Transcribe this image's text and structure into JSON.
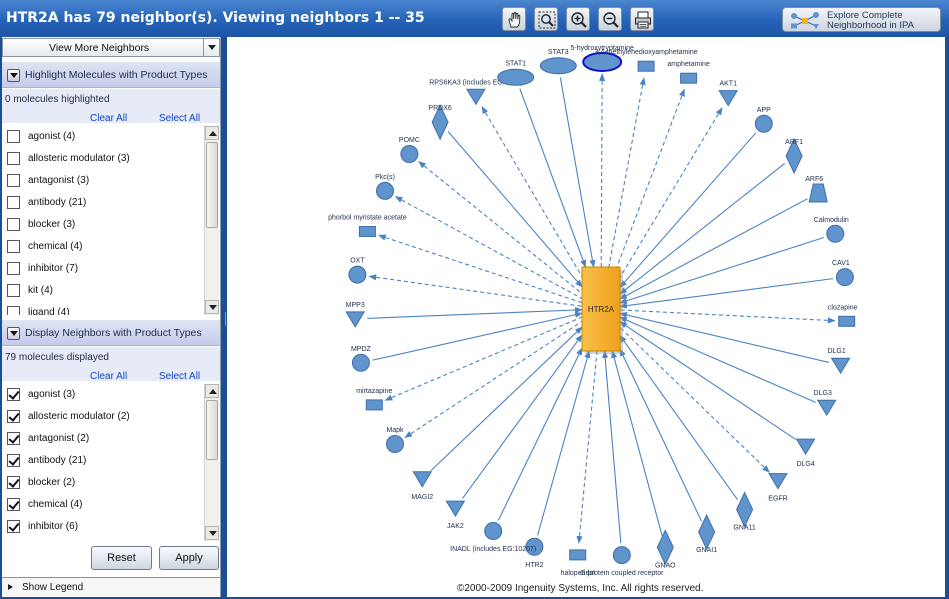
{
  "window": {
    "title": "HTR2A has 79 neighbor(s). Viewing neighbors 1 -- 35",
    "explore_button": "Explore Complete Neighborhood in IPA"
  },
  "toolbar": {
    "tools": [
      {
        "name": "pan",
        "icon": "hand-icon"
      },
      {
        "name": "zoom-fit",
        "icon": "magnifier-icon"
      },
      {
        "name": "zoom-in",
        "icon": "zoom-in-icon"
      },
      {
        "name": "zoom-out",
        "icon": "zoom-out-icon"
      },
      {
        "name": "print",
        "icon": "printer-icon"
      }
    ]
  },
  "sidebar": {
    "view_more": "View More Neighbors",
    "highlight": {
      "title": "Highlight Molecules with Product Types",
      "count": "0 molecules highlighted",
      "clear_all": "Clear All",
      "select_all": "Select All",
      "items": [
        {
          "label": "agonist (4)",
          "checked": false
        },
        {
          "label": "allosteric modulator (3)",
          "checked": false
        },
        {
          "label": "antagonist (3)",
          "checked": false
        },
        {
          "label": "antibody (21)",
          "checked": false
        },
        {
          "label": "blocker (3)",
          "checked": false
        },
        {
          "label": "chemical (4)",
          "checked": false
        },
        {
          "label": "inhibitor (7)",
          "checked": false
        },
        {
          "label": "kit (4)",
          "checked": false
        },
        {
          "label": "ligand (4)",
          "checked": false
        }
      ]
    },
    "display": {
      "title": "Display Neighbors with Product Types",
      "count": "79 molecules displayed",
      "clear_all": "Clear All",
      "select_all": "Select All",
      "items": [
        {
          "label": "agonist (3)",
          "checked": true
        },
        {
          "label": "allosteric modulator (2)",
          "checked": true
        },
        {
          "label": "antagonist (2)",
          "checked": true
        },
        {
          "label": "antibody (21)",
          "checked": true
        },
        {
          "label": "blocker (2)",
          "checked": true
        },
        {
          "label": "chemical (4)",
          "checked": true
        },
        {
          "label": "inhibitor (6)",
          "checked": true
        }
      ]
    },
    "reset": "Reset",
    "apply": "Apply",
    "show_legend": "Show Legend"
  },
  "network": {
    "center": "HTR2A",
    "node_color": "#5f94cc",
    "center_color": "#f5ad23",
    "edge_color": "#4a82c4",
    "nodes": [
      {
        "label": "STAT3",
        "shape": "ellipse",
        "edge": "solid"
      },
      {
        "label": "5-hydroxytryptamine",
        "shape": "ellipse-selected",
        "edge": "dashed"
      },
      {
        "label": "3,4-methylenedioxyamphetamine",
        "shape": "rect",
        "edge": "dashed"
      },
      {
        "label": "amphetamine",
        "shape": "rect",
        "edge": "dashed"
      },
      {
        "label": "AKT1",
        "shape": "triangle",
        "edge": "dashed"
      },
      {
        "label": "APP",
        "shape": "circle",
        "edge": "solid"
      },
      {
        "label": "ARF1",
        "shape": "diamond",
        "edge": "solid"
      },
      {
        "label": "ARF6",
        "shape": "trapezoid",
        "edge": "solid"
      },
      {
        "label": "Calmodulin",
        "shape": "circle",
        "edge": "solid"
      },
      {
        "label": "CAV1",
        "shape": "circle",
        "edge": "solid"
      },
      {
        "label": "clozapine",
        "shape": "rect",
        "edge": "dashed"
      },
      {
        "label": "DLG1",
        "shape": "triangle",
        "edge": "solid"
      },
      {
        "label": "DLG3",
        "shape": "triangle",
        "edge": "solid"
      },
      {
        "label": "DLG4",
        "shape": "triangle",
        "edge": "solid"
      },
      {
        "label": "EGFR",
        "shape": "triangle",
        "edge": "dashed"
      },
      {
        "label": "GNA11",
        "shape": "diamond",
        "edge": "solid"
      },
      {
        "label": "GNAI1",
        "shape": "diamond",
        "edge": "solid"
      },
      {
        "label": "GNAO",
        "shape": "diamond",
        "edge": "solid"
      },
      {
        "label": "G-protein coupled receptor",
        "shape": "circle",
        "edge": "solid"
      },
      {
        "label": "haloperidol",
        "shape": "rect",
        "edge": "dashed"
      },
      {
        "label": "HTR2",
        "shape": "circle",
        "edge": "solid"
      },
      {
        "label": "INADL (includes EG:10207)",
        "shape": "circle",
        "edge": "solid"
      },
      {
        "label": "JAK2",
        "shape": "triangle",
        "edge": "solid"
      },
      {
        "label": "MAGI2",
        "shape": "triangle",
        "edge": "solid"
      },
      {
        "label": "Mapk",
        "shape": "circle",
        "edge": "dashed"
      },
      {
        "label": "mirtazapine",
        "shape": "rect",
        "edge": "dashed"
      },
      {
        "label": "MPDZ",
        "shape": "circle",
        "edge": "solid"
      },
      {
        "label": "MPP3",
        "shape": "triangle",
        "edge": "solid"
      },
      {
        "label": "OXT",
        "shape": "circle",
        "edge": "dashed"
      },
      {
        "label": "phorbol myristate acetate",
        "shape": "rect",
        "edge": "dashed"
      },
      {
        "label": "Pkc(s)",
        "shape": "circle",
        "edge": "dashed"
      },
      {
        "label": "POMC",
        "shape": "circle",
        "edge": "dashed"
      },
      {
        "label": "PRDX6",
        "shape": "diamond",
        "edge": "solid"
      },
      {
        "label": "RPS6KA3 (includes EG:6197)",
        "shape": "triangle",
        "edge": "dashed"
      },
      {
        "label": "STAT1",
        "shape": "ellipse",
        "edge": "solid"
      }
    ]
  },
  "footer": {
    "copyright": "©2000-2009 Ingenuity Systems, Inc. All rights reserved."
  }
}
